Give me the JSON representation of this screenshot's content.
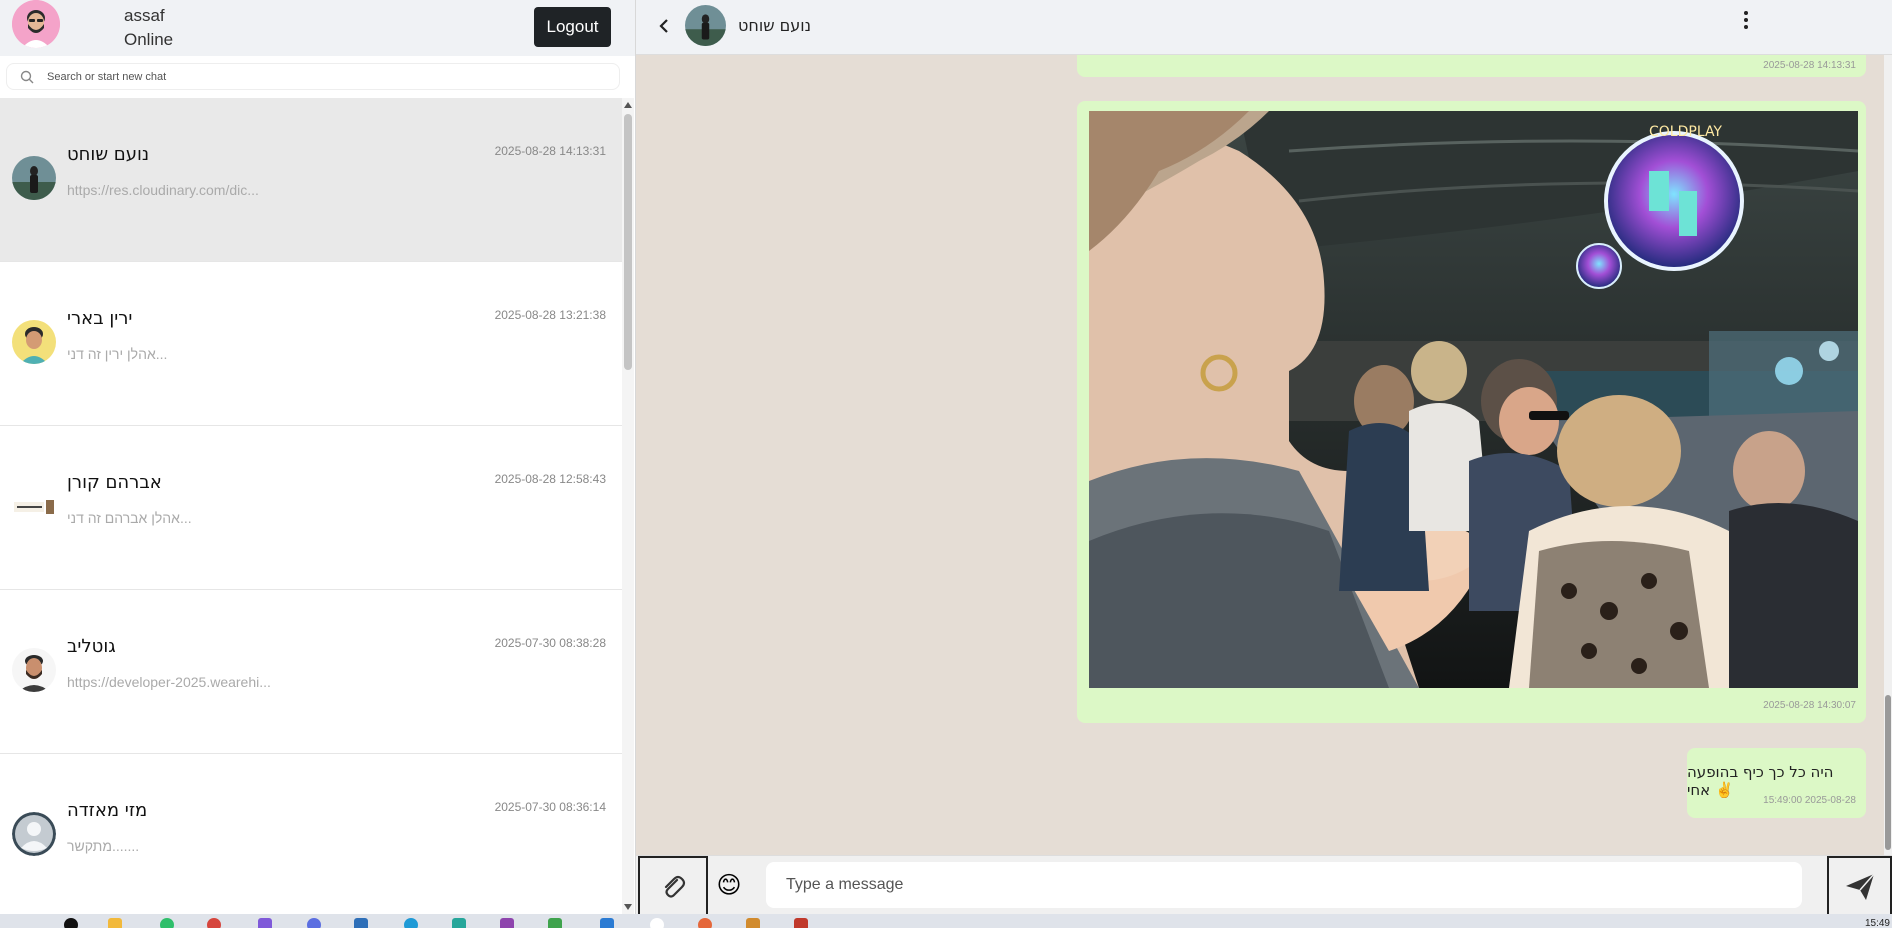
{
  "me": {
    "name": "assaf",
    "status": "Online",
    "logout_label": "Logout"
  },
  "search": {
    "placeholder": "Search or start new chat"
  },
  "chats": [
    {
      "name": "נועם שוחט",
      "time": "2025-08-28 14:13:31",
      "preview": "https://res.cloudinary.com/dic...",
      "active": true
    },
    {
      "name": "ירין בארי",
      "time": "2025-08-28 13:21:38",
      "preview": "אהלן ירין זה דני...",
      "active": false
    },
    {
      "name": "אברהם קורן",
      "time": "2025-08-28 12:58:43",
      "preview": "אהלן אברהם זה דני...",
      "active": false
    },
    {
      "name": "גוטליב",
      "time": "2025-07-30 08:38:28",
      "preview": "https://developer-2025.wearehi...",
      "active": false
    },
    {
      "name": "מזי מאזדה",
      "time": "2025-07-30 08:36:14",
      "preview": "מתקשר.......",
      "active": false
    }
  ],
  "conversation": {
    "contact_name": "נועם שוחט",
    "messages": [
      {
        "kind": "text-partial",
        "time": "2025-08-28 14:13:31"
      },
      {
        "kind": "image",
        "time": "2025-08-28 14:30:07",
        "image_desc": "concert-photo"
      },
      {
        "kind": "text",
        "text": "היה כל כך כיף בהופעה אחי ✌️",
        "time": "15:49:00 2025-08-28"
      }
    ]
  },
  "composer": {
    "placeholder": "Type a message",
    "emoji": "😊"
  },
  "taskbar": {
    "clock": "15:49"
  },
  "colors": {
    "bubble": "#dcf8c6",
    "chat_bg": "#e5ddd5",
    "header_bg": "#f0f2f5",
    "logout_bg": "#1f2326"
  }
}
